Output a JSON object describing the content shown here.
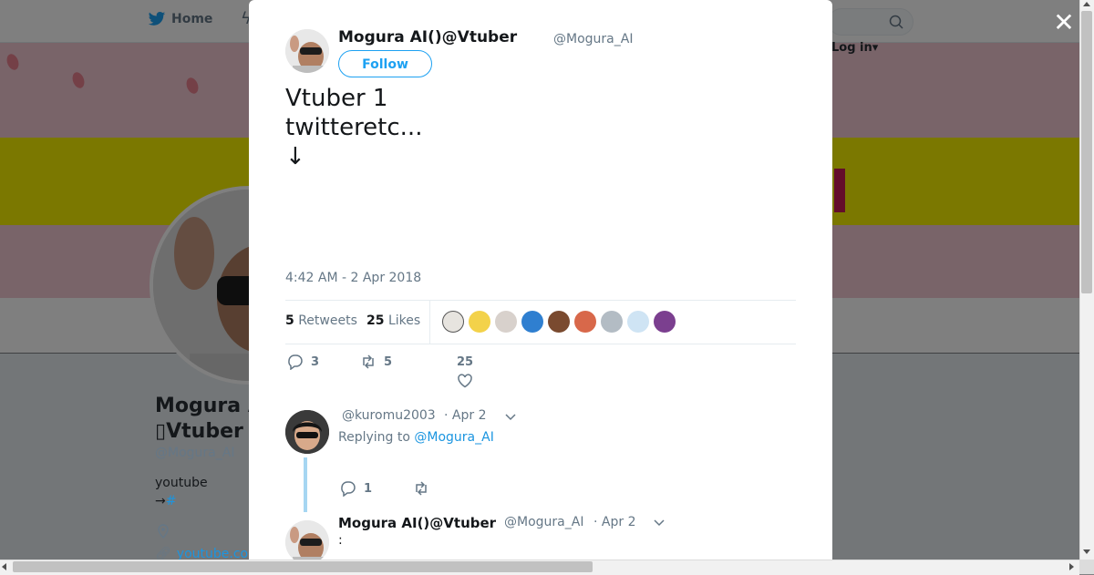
{
  "topbar": {
    "home_label": "Home",
    "login_label": "Log in",
    "search_placeholder": ""
  },
  "profile": {
    "name_line1": "Mogura A",
    "name_line2": "Vtuber",
    "handle": "@Mogura_AI",
    "bio_line1": "youtube",
    "bio_arrow": "→",
    "bio_hash": "#",
    "website": "youtube.co"
  },
  "modal": {
    "close_label": "✕",
    "author": {
      "name": "Mogura AI()@Vtuber",
      "handle": "@Mogura_AI",
      "follow_label": "Follow"
    },
    "tweet_text": "Vtuber 1\ntwitteretc...\n↓\n\n\n",
    "timestamp": "4:42 AM - 2 Apr 2018",
    "stats": {
      "retweets_count": "5",
      "retweets_label": "Retweets",
      "likes_count": "25",
      "likes_label": "Likes"
    },
    "actions": {
      "reply_count": "3",
      "retweet_count": "5",
      "like_count": "25"
    },
    "reply": {
      "handle": "@kuromu2003",
      "date": "· Apr 2",
      "replying_prefix": "Replying to",
      "replying_handle": "@Mogura_AI",
      "reply_count": "1"
    },
    "tweet2": {
      "name": "Mogura AI()@Vtuber",
      "handle": "@Mogura_AI",
      "date": "· Apr 2",
      "text": ":"
    }
  },
  "colors": {
    "accent": "#1da1f2",
    "link": "#1b95e0",
    "muted": "#657786",
    "banner_pink": "#f2c9d2",
    "banner_yellow": "#f6f000"
  }
}
